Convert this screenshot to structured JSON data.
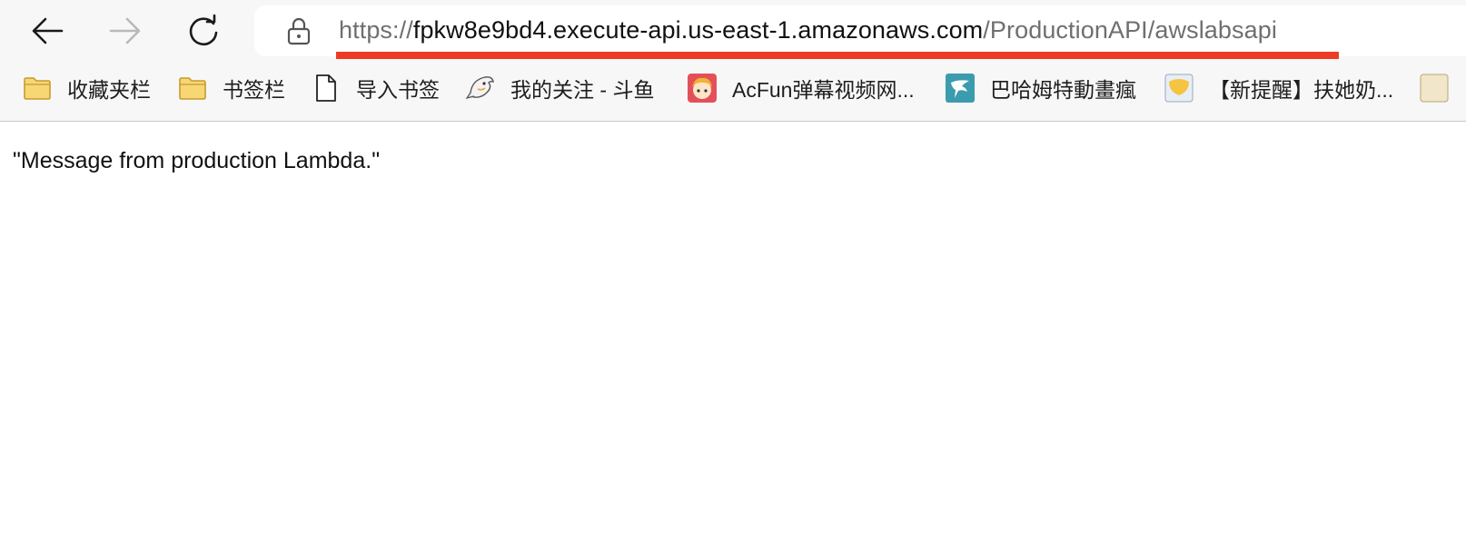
{
  "toolbar": {
    "back_label": "Back",
    "forward_label": "Forward",
    "reload_label": "Reload"
  },
  "address": {
    "scheme": "https://",
    "host": "fpkw8e9bd4.execute-api.us-east-1.amazonaws.com",
    "path": "/ProductionAPI/awslabsapi",
    "highlight_color": "#ee3b25"
  },
  "bookmarks": [
    {
      "label": "收藏夹栏",
      "icon": "folder-icon"
    },
    {
      "label": "书签栏",
      "icon": "folder-icon"
    },
    {
      "label": "导入书签",
      "icon": "page-icon"
    },
    {
      "label": "我的关注 - 斗鱼",
      "icon": "douyu-fish-icon"
    },
    {
      "label": "AcFun弹幕视频网...",
      "icon": "acfun-icon"
    },
    {
      "label": "巴哈姆特動畫瘋",
      "icon": "bahamut-icon"
    },
    {
      "label": "【新提醒】扶她奶...",
      "icon": "site-icon"
    }
  ],
  "page": {
    "body_text": "\"Message from production Lambda.\""
  },
  "colors": {
    "chrome_background": "#f7f7f7",
    "folder": "#f7d774"
  }
}
